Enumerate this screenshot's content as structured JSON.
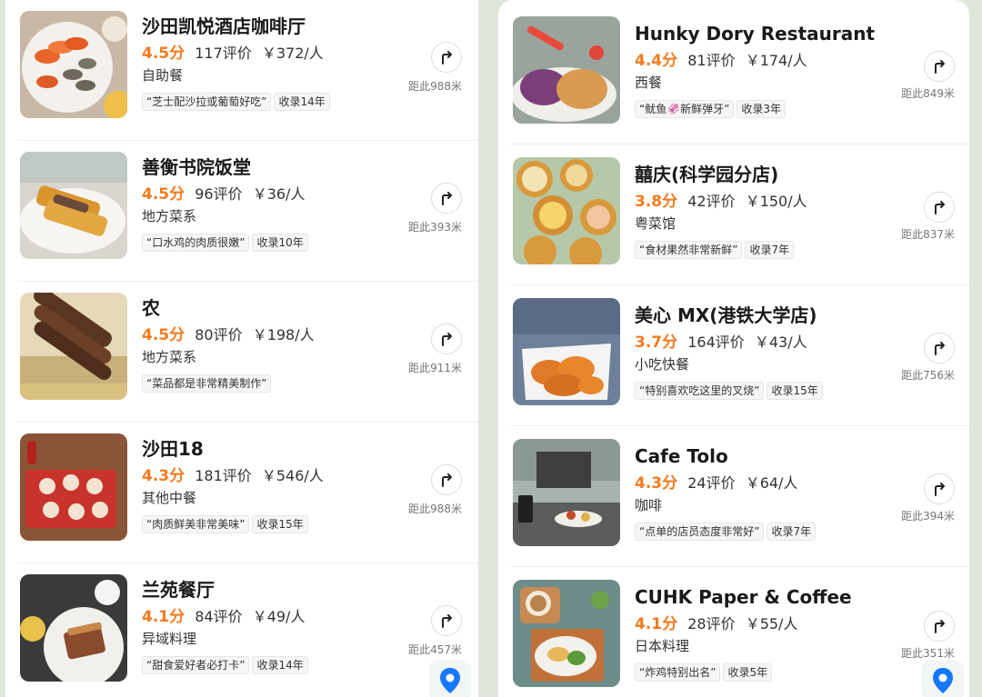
{
  "left": {
    "items": [
      {
        "name": "沙田凯悦酒店咖啡厅",
        "score": "4.5分",
        "reviews": "117评价",
        "price": "￥372/人",
        "category": "自助餐",
        "quote": "“芝士配沙拉或葡萄好吃”",
        "years": "收录14年",
        "distance": "距此988米",
        "thumb_icon": "seafood-buffet-photo"
      },
      {
        "name": "善衡书院饭堂",
        "score": "4.5分",
        "reviews": "96评价",
        "price": "￥36/人",
        "category": "地方菜系",
        "quote": "“口水鸡的肉质很嫩”",
        "years": "收录10年",
        "distance": "距此393米",
        "thumb_icon": "toast-dish-photo"
      },
      {
        "name": "农",
        "score": "4.5分",
        "reviews": "80评价",
        "price": "￥198/人",
        "category": "地方菜系",
        "quote": "“菜品都是非常精美制作”",
        "years": "",
        "distance": "距此911米",
        "thumb_icon": "rolls-platter-photo"
      },
      {
        "name": "沙田18",
        "score": "4.3分",
        "reviews": "181评价",
        "price": "￥546/人",
        "category": "其他中餐",
        "quote": "“肉质鲜美非常美味”",
        "years": "收录15年",
        "distance": "距此988米",
        "thumb_icon": "dim-sum-tray-photo"
      },
      {
        "name": "兰苑餐厅",
        "score": "4.1分",
        "reviews": "84评价",
        "price": "￥49/人",
        "category": "异域料理",
        "quote": "“甜食爱好者必打卡”",
        "years": "收录14年",
        "distance": "距此457米",
        "thumb_icon": "dessert-plate-photo"
      }
    ]
  },
  "right": {
    "items": [
      {
        "name": "Hunky Dory Restaurant",
        "score": "4.4分",
        "reviews": "81评价",
        "price": "￥174/人",
        "category": "西餐",
        "quote": "“鱿鱼🦑新鲜弹牙”",
        "years": "收录3年",
        "distance": "距此849米",
        "thumb_icon": "pastry-plate-photo"
      },
      {
        "name": "囍庆(科学园分店)",
        "score": "3.8分",
        "reviews": "42评价",
        "price": "￥150/人",
        "category": "粤菜馆",
        "quote": "“食材果然非常新鲜”",
        "years": "收录7年",
        "distance": "距此837米",
        "thumb_icon": "dim-sum-baskets-photo"
      },
      {
        "name": "美心 MX(港铁大学店)",
        "score": "3.7分",
        "reviews": "164评价",
        "price": "￥43/人",
        "category": "小吃快餐",
        "quote": "“特别喜欢吃这里的叉烧”",
        "years": "收录15年",
        "distance": "距此756米",
        "thumb_icon": "fried-chicken-box-photo"
      },
      {
        "name": "Cafe Tolo",
        "score": "4.3分",
        "reviews": "24评价",
        "price": "￥64/人",
        "category": "咖啡",
        "quote": "“点单的店员态度非常好”",
        "years": "收录7年",
        "distance": "距此394米",
        "thumb_icon": "cafe-terrace-photo"
      },
      {
        "name": "CUHK Paper & Coffee",
        "score": "4.1分",
        "reviews": "28评价",
        "price": "￥55/人",
        "category": "日本料理",
        "quote": "“炸鸡特别出名”",
        "years": "收录5年",
        "distance": "距此351米",
        "thumb_icon": "coffee-brunch-photo"
      }
    ]
  },
  "icons": {
    "route": "route-arrow-icon",
    "map": "map-pin-icon"
  },
  "colors": {
    "score": "#f47a1f",
    "map_pin": "#1677ff"
  }
}
